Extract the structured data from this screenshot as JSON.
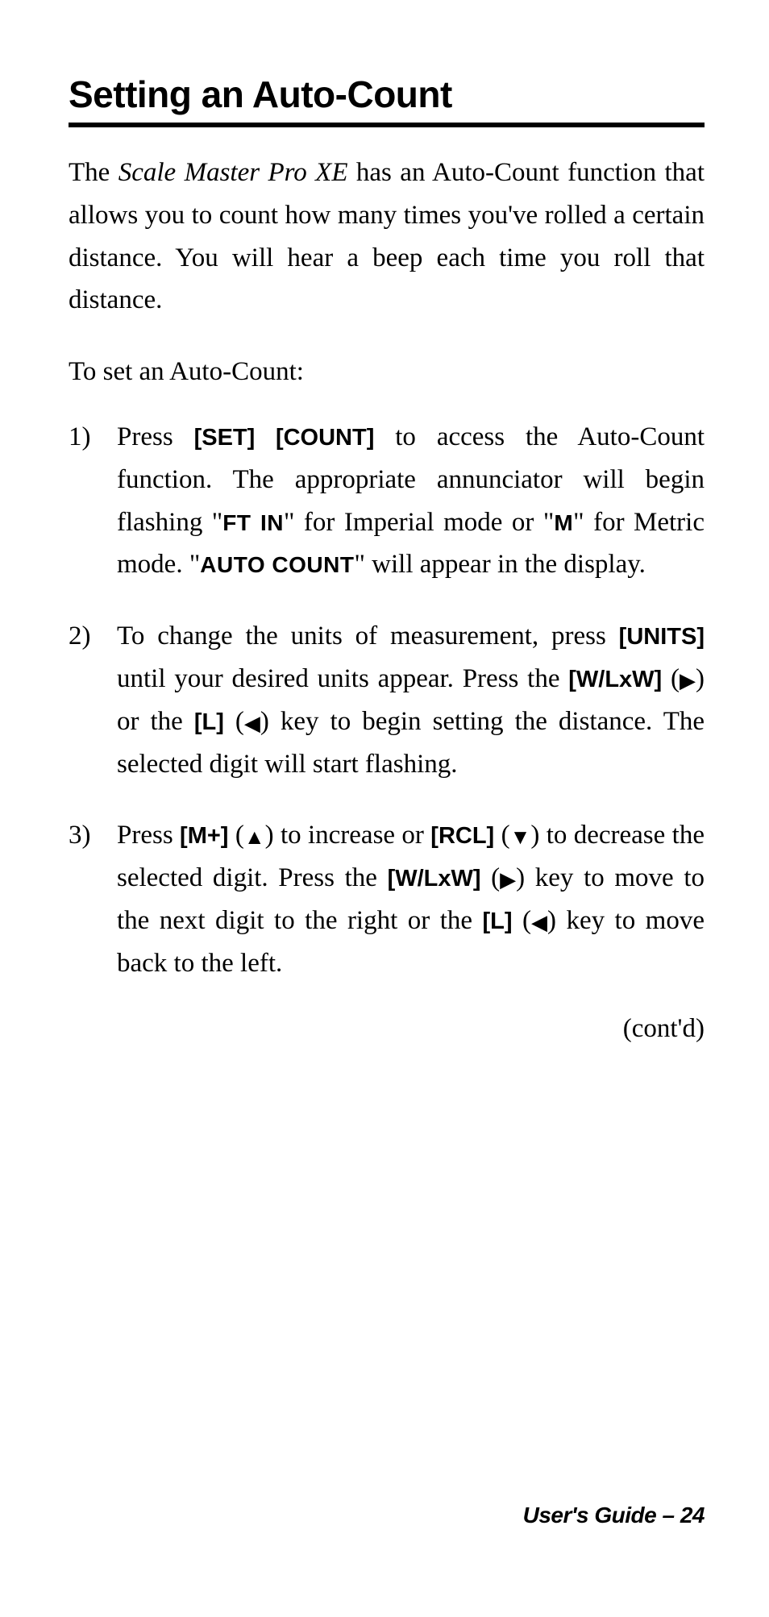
{
  "title": "Setting an Auto-Count",
  "intro": {
    "prefix": "The ",
    "product": "Scale Master Pro XE",
    "suffix": " has an Auto-Count function that allows you to count how many times you've rolled a certain distance. You will hear a beep each time you roll that distance."
  },
  "leadin": "To set an Auto-Count:",
  "steps": [
    {
      "num": "1)",
      "parts": {
        "a": "Press ",
        "k1": "[SET] [COUNT]",
        "b": " to access the Auto-Count function. The appropriate annunciator will begin flashing \"",
        "s1": "FT IN",
        "c": "\" for Imperial mode or \"",
        "s2": "M",
        "d": "\" for Metric mode. \"",
        "s3": "AUTO COUNT",
        "e": "\" will appear in the display."
      }
    },
    {
      "num": "2)",
      "parts": {
        "a": "To change the units of measurement, press ",
        "k1": "[UNITS]",
        "b": " until your desired units appear. Press the ",
        "k2": "[W/LxW]",
        "c": " (",
        "ar1": "▶",
        "d": ") or the ",
        "k3": "[L]",
        "e": " (",
        "ar2": "◀",
        "f": ") key to begin setting the distance. The selected digit will start flashing."
      }
    },
    {
      "num": "3)",
      "parts": {
        "a": "Press ",
        "k1": "[M+]",
        "b": " (",
        "ar1": "▲",
        "c": ") to increase or ",
        "k2": "[RCL]",
        "d": " (",
        "ar2": "▼",
        "e": ") to decrease the selected digit. Press the ",
        "k3": "[W/LxW]",
        "f": " (",
        "ar3": "▶",
        "g": ") key to move to the next digit to the right or the ",
        "k4": "[L]",
        "h": " (",
        "ar4": "◀",
        "i": ") key to move back to the left."
      }
    }
  ],
  "contd": "(cont'd)",
  "footer": "User's Guide – 24"
}
